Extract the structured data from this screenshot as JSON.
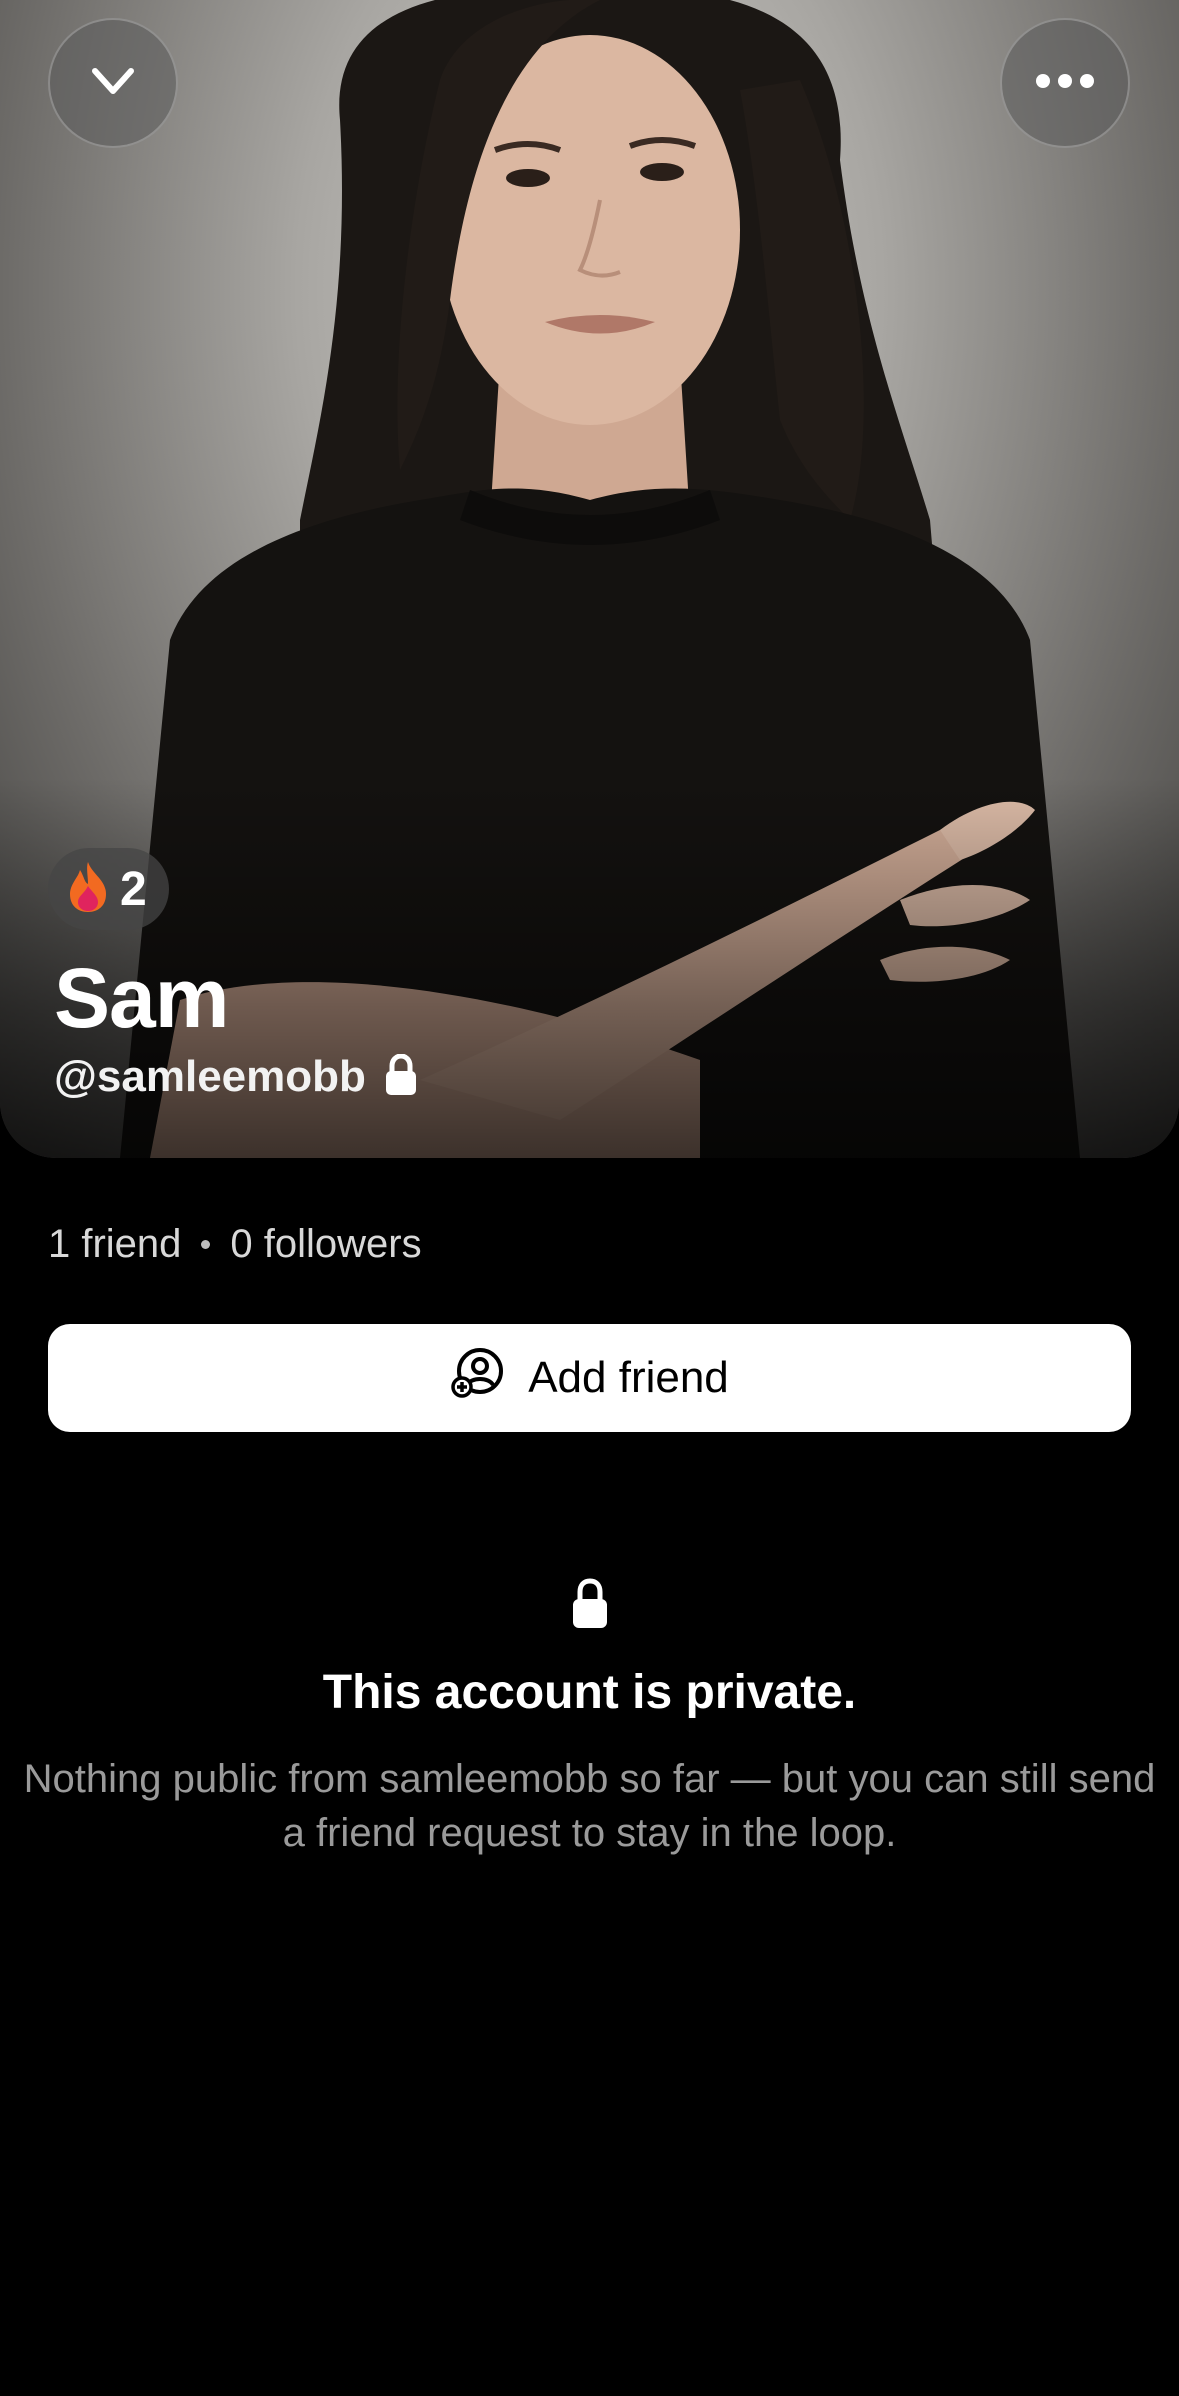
{
  "profile": {
    "name": "Sam",
    "handle": "@samleemobb",
    "streak_count": "2"
  },
  "stats": {
    "friends": "1 friend",
    "followers": "0 followers"
  },
  "actions": {
    "add_friend_label": "Add friend"
  },
  "private_notice": {
    "title": "This account is private.",
    "body": "Nothing public from samleemobb so far — but you can still send a friend request to stay in the loop."
  },
  "icons": {
    "back": "chevron-down-icon",
    "more": "more-horizontal-icon",
    "streak": "fire-icon",
    "private": "lock-icon",
    "add_friend": "add-user-icon"
  },
  "colors": {
    "background": "#000000",
    "button_bg": "#ffffff",
    "muted_text": "#9a9a9a"
  }
}
